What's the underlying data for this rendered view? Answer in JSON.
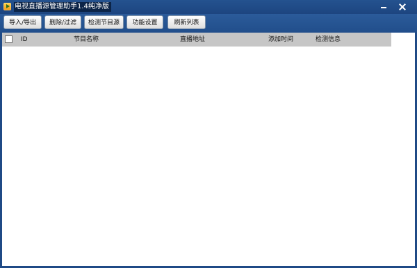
{
  "window": {
    "title": "电视直播源管理助手1.4纯净版"
  },
  "toolbar": {
    "buttons": [
      "导入/导出",
      "删除/过滤",
      "检测节目源",
      "功能设置",
      "刷新列表"
    ]
  },
  "list": {
    "columns": {
      "id": "ID",
      "name": "节目名称",
      "url": "直播地址",
      "time": "添加时间",
      "info": "检测信息"
    },
    "rows": []
  }
}
